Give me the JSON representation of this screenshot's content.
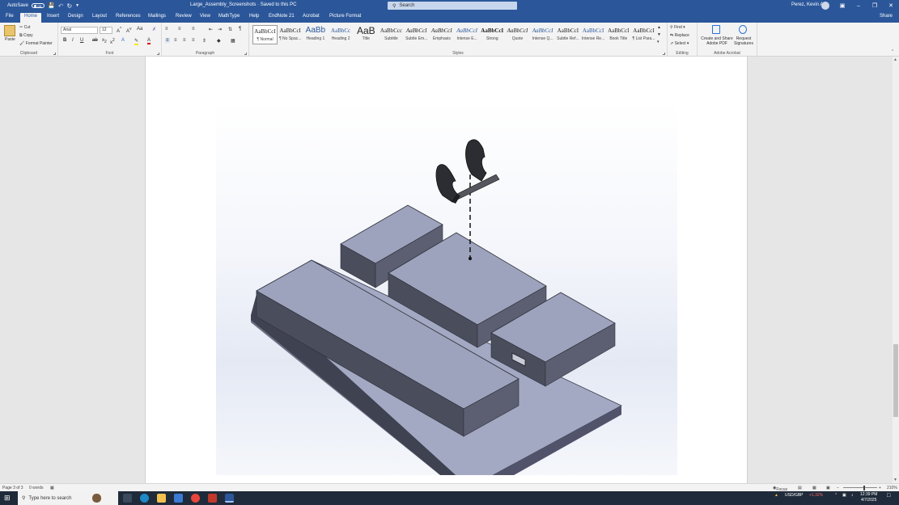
{
  "titlebar": {
    "autosave_label": "AutoSave",
    "autosave_state": "Off",
    "doc_title": "Large_Assembly_Screenshots  ·  Saved to this PC",
    "search_placeholder": "Search",
    "user_name": "Perez, Kevin A"
  },
  "menu": {
    "tabs": [
      "File",
      "Home",
      "Insert",
      "Design",
      "Layout",
      "References",
      "Mailings",
      "Review",
      "View",
      "MathType",
      "Help",
      "EndNote 21",
      "Acrobat",
      "Picture Format"
    ],
    "active": "Home",
    "share_label": "Share"
  },
  "ribbon": {
    "clipboard": {
      "paste": "Paste",
      "cut": "Cut",
      "copy": "Copy",
      "format_painter": "Format Painter",
      "label": "Clipboard"
    },
    "font": {
      "family": "Arial",
      "size": "12",
      "label": "Font"
    },
    "paragraph": {
      "label": "Paragraph"
    },
    "styles": {
      "label": "Styles",
      "items": [
        {
          "preview": "AaBbCcI",
          "name": "¶ Normal"
        },
        {
          "preview": "AaBbCcI",
          "name": "¶ No Spac..."
        },
        {
          "preview": "AaBb",
          "name": "Heading 1"
        },
        {
          "preview": "AaBbCc",
          "name": "Heading 2"
        },
        {
          "preview": "AaB",
          "name": "Title"
        },
        {
          "preview": "AaBbCcc",
          "name": "Subtitle"
        },
        {
          "preview": "AaBbCcI",
          "name": "Subtle Em..."
        },
        {
          "preview": "AaBbCcI",
          "name": "Emphasis"
        },
        {
          "preview": "AaBbCcI",
          "name": "Intense E..."
        },
        {
          "preview": "AaBbCcI",
          "name": "Strong"
        },
        {
          "preview": "AaBbCcI",
          "name": "Quote"
        },
        {
          "preview": "AaBbCcI",
          "name": "Intense Q..."
        },
        {
          "preview": "AaBbCcI",
          "name": "Subtle Ref..."
        },
        {
          "preview": "AaBbCcI",
          "name": "Intense Re..."
        },
        {
          "preview": "AaBbCcI",
          "name": "Book Title"
        },
        {
          "preview": "AaBbCcI",
          "name": "¶ List Para..."
        }
      ]
    },
    "editing": {
      "find": "Find",
      "replace": "Replace",
      "select": "Select",
      "label": "Editing"
    },
    "acrobat": {
      "create_pdf": "Create and Share Adobe PDF",
      "request_sig": "Request Signatures",
      "label": "Adobe Acrobat"
    }
  },
  "status": {
    "page": "Page 3 of 3",
    "words": "0 words",
    "focus": "Focus",
    "zoom": "210%"
  },
  "taskbar": {
    "search_placeholder": "Type here to search",
    "ticker": "USD/GBP",
    "ticker_change": "+1.32%",
    "time": "12:39 PM",
    "date": "4/7/2025"
  },
  "colors": {
    "word_blue": "#2b579a",
    "part_top": "#9ea3bd",
    "part_side": "#4a4d5c"
  }
}
